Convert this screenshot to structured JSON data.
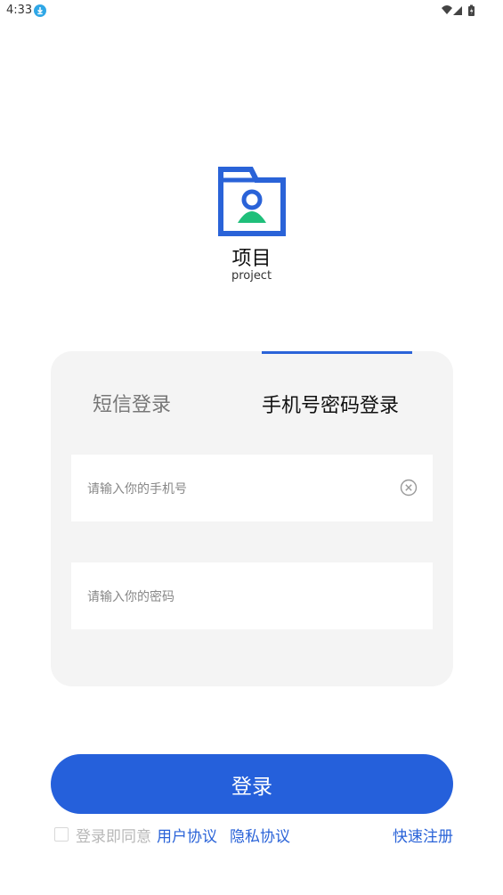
{
  "status_bar": {
    "time": "4:33",
    "icons": [
      "download-icon",
      "wifi-icon",
      "signal-icon",
      "battery-icon"
    ]
  },
  "brand": {
    "logo_icon": "folder-user-icon",
    "name": "项目",
    "subtitle": "project"
  },
  "tabs": [
    {
      "label": "短信登录",
      "active": false
    },
    {
      "label": "手机号密码登录",
      "active": true
    }
  ],
  "form": {
    "phone_placeholder": "请输入你的手机号",
    "phone_value": "",
    "password_placeholder": "请输入你的密码",
    "password_value": ""
  },
  "login_button": "登录",
  "agreement": {
    "prefix": "登录即同意",
    "user_agreement": "用户协议",
    "privacy_agreement": "隐私协议",
    "checked": false
  },
  "register_link": "快速注册",
  "colors": {
    "accent": "#2560db",
    "logo_blue": "#2a63d8",
    "logo_green": "#1fbf7a",
    "card_bg": "#f4f4f4"
  }
}
